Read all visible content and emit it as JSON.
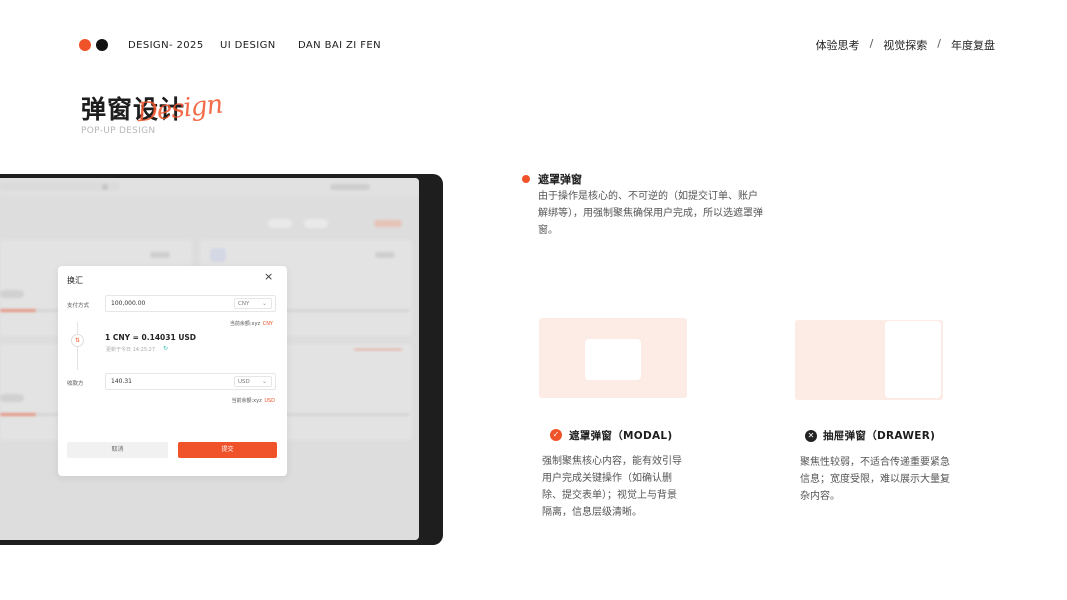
{
  "header": {
    "brand_colors": [
      "#f0532a",
      "#111111"
    ],
    "nav": [
      "DESIGN- 2025",
      "UI DESIGN",
      "DAN BAI ZI FEN"
    ],
    "breadcrumbs": [
      "体验思考",
      "视觉探索",
      "年度复盘"
    ],
    "separator": "/"
  },
  "title": {
    "cn": "弹窗设计",
    "script": "Design",
    "en": "POP-UP DESIGN"
  },
  "modal": {
    "title": "换汇",
    "close_icon": "×",
    "pay_label": "支付方式",
    "pay_value": "100,000.00",
    "pay_currency": "CNY",
    "pay_balance_prefix": "当前余额:xyz",
    "pay_balance_currency": "CNY",
    "rate": "1 CNY = 0.14031 USD",
    "rate_updated": "更新于今日  14:25:27",
    "receive_label": "收款方",
    "receive_value": "140.31",
    "receive_currency": "USD",
    "receive_balance_prefix": "当前余额:xyz",
    "receive_balance_currency": "USD",
    "cancel": "取消",
    "submit": "提交"
  },
  "section": {
    "title": "遮罩弹窗",
    "desc": "由于操作是核心的、不可逆的（如提交订单、账户解绑等），用强制聚焦确保用户完成，所以选遮罩弹窗。"
  },
  "options": {
    "modal": {
      "title": "遮罩弹窗（MODAL)",
      "desc": "强制聚焦核心内容，能有效引导用户完成关键操作（如确认删除、提交表单）；视觉上与背景隔离，信息层级清晰。",
      "icon_color": "#f0532a"
    },
    "drawer": {
      "title": "抽屉弹窗（DRAWER)",
      "desc": "聚焦性较弱，不适合传递重要紧急信息；宽度受限，难以展示大量复杂内容。",
      "icon_color": "#222222"
    }
  },
  "colors": {
    "accent": "#f0532a",
    "accent_light": "#fdebe5",
    "device_frame": "#1e1e1e"
  }
}
